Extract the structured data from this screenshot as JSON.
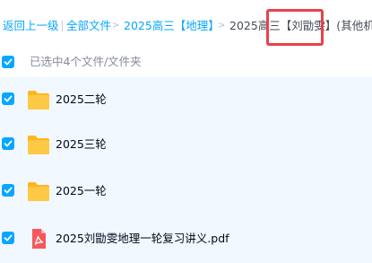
{
  "breadcrumb": {
    "back_label": "返回上一级",
    "all_files_label": "全部文件",
    "parent_folder_label": "2025高三【地理】",
    "current_folder_label": "2025高三【刘勖雯】(其他机..."
  },
  "selection": {
    "checked": true,
    "summary_text": "已选中4个文件/文件夹"
  },
  "files": [
    {
      "name": "2025二轮",
      "type": "folder",
      "checked": true
    },
    {
      "name": "2025三轮",
      "type": "folder",
      "checked": true
    },
    {
      "name": "2025一轮",
      "type": "folder",
      "checked": true
    },
    {
      "name": "2025刘勖雯地理一轮复习讲义.pdf",
      "type": "pdf",
      "checked": true
    }
  ],
  "colors": {
    "accent": "#06a7ff",
    "row_selected_bg": "#f2f8ff",
    "highlight_border": "#e9424a",
    "folder_yellow": "#ffc53d",
    "pdf_red": "#f5595c"
  },
  "icons": {
    "folder": "folder-icon",
    "pdf": "pdf-file-icon",
    "check": "check-icon",
    "arrow": "chevron-right-icon"
  }
}
